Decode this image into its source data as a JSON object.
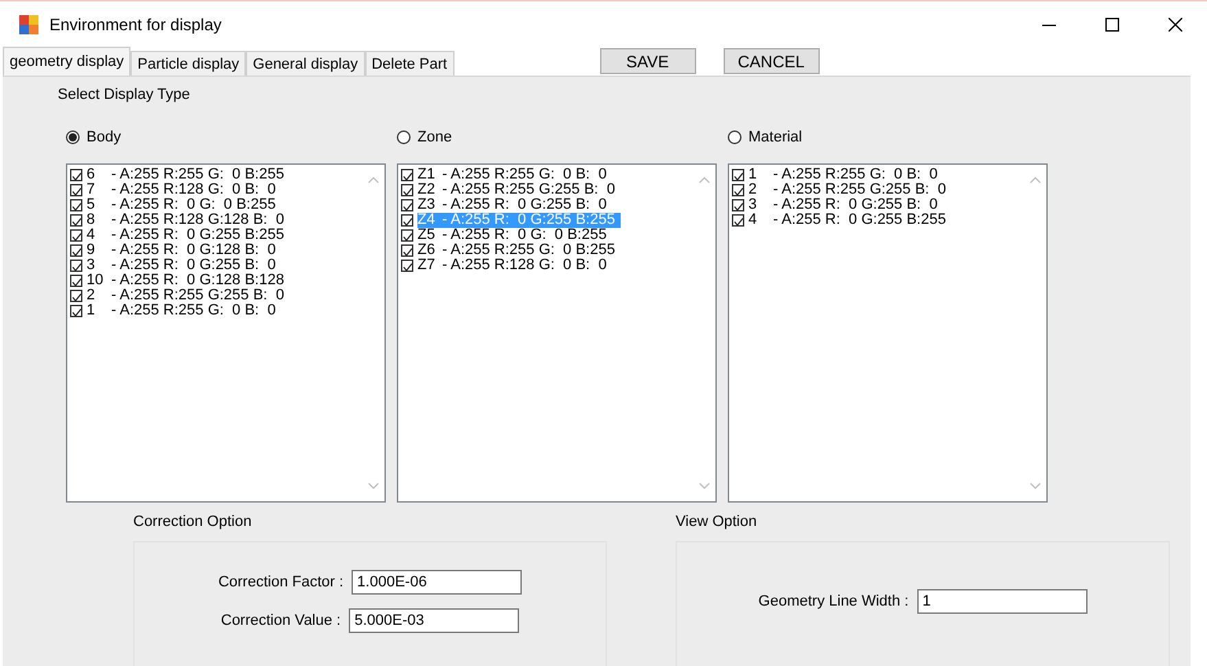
{
  "window": {
    "title": "Environment for display"
  },
  "tabs": [
    {
      "label": "geometry display",
      "selected": true
    },
    {
      "label": "Particle display",
      "selected": false
    },
    {
      "label": "General display",
      "selected": false
    },
    {
      "label": "Delete Part",
      "selected": false
    }
  ],
  "buttons": [
    {
      "label": "SAVE"
    },
    {
      "label": "CANCEL"
    }
  ],
  "display_type": {
    "title": "Select Display Type",
    "options": [
      {
        "label": "Body",
        "selected": true,
        "items": [
          {
            "id": "6",
            "text": "- A:255 R:255 G:  0 B:255",
            "checked": true,
            "selected": false
          },
          {
            "id": "7",
            "text": "- A:255 R:128 G:  0 B:  0",
            "checked": true,
            "selected": false
          },
          {
            "id": "5",
            "text": "- A:255 R:  0 G:  0 B:255",
            "checked": true,
            "selected": false
          },
          {
            "id": "8",
            "text": "- A:255 R:128 G:128 B:  0",
            "checked": true,
            "selected": false
          },
          {
            "id": "4",
            "text": "- A:255 R:  0 G:255 B:255",
            "checked": true,
            "selected": false
          },
          {
            "id": "9",
            "text": "- A:255 R:  0 G:128 B:  0",
            "checked": true,
            "selected": false
          },
          {
            "id": "3",
            "text": "- A:255 R:  0 G:255 B:  0",
            "checked": true,
            "selected": false
          },
          {
            "id": "10",
            "text": "- A:255 R:  0 G:128 B:128",
            "checked": true,
            "selected": false
          },
          {
            "id": "2",
            "text": "- A:255 R:255 G:255 B:  0",
            "checked": true,
            "selected": false
          },
          {
            "id": "1",
            "text": "- A:255 R:255 G:  0 B:  0",
            "checked": true,
            "selected": false
          }
        ]
      },
      {
        "label": "Zone",
        "selected": false,
        "items": [
          {
            "id": "Z1",
            "text": "- A:255 R:255 G:  0 B:  0",
            "checked": true,
            "selected": false
          },
          {
            "id": "Z2",
            "text": "- A:255 R:255 G:255 B:  0",
            "checked": true,
            "selected": false
          },
          {
            "id": "Z3",
            "text": "- A:255 R:  0 G:255 B:  0",
            "checked": true,
            "selected": false
          },
          {
            "id": "Z4",
            "text": "- A:255 R:  0 G:255 B:255",
            "checked": true,
            "selected": true
          },
          {
            "id": "Z5",
            "text": "- A:255 R:  0 G:  0 B:255",
            "checked": true,
            "selected": false
          },
          {
            "id": "Z6",
            "text": "- A:255 R:255 G:  0 B:255",
            "checked": true,
            "selected": false
          },
          {
            "id": "Z7",
            "text": "- A:255 R:128 G:  0 B:  0",
            "checked": true,
            "selected": false
          }
        ]
      },
      {
        "label": "Material",
        "selected": false,
        "items": [
          {
            "id": "1",
            "text": "- A:255 R:255 G:  0 B:  0",
            "checked": true,
            "selected": false
          },
          {
            "id": "2",
            "text": "- A:255 R:255 G:255 B:  0",
            "checked": true,
            "selected": false
          },
          {
            "id": "3",
            "text": "- A:255 R:  0 G:255 B:  0",
            "checked": true,
            "selected": false
          },
          {
            "id": "4",
            "text": "- A:255 R:  0 G:255 B:255",
            "checked": true,
            "selected": false
          }
        ]
      }
    ]
  },
  "correction_option": {
    "title": "Correction Option",
    "fields": [
      {
        "label": "Correction Factor :",
        "value": "1.000E-06"
      },
      {
        "label": "Correction Value :",
        "value": "5.000E-03"
      }
    ]
  },
  "view_option": {
    "title": "View Option",
    "fields": [
      {
        "label": "Geometry Line Width :",
        "value": "1"
      }
    ]
  }
}
